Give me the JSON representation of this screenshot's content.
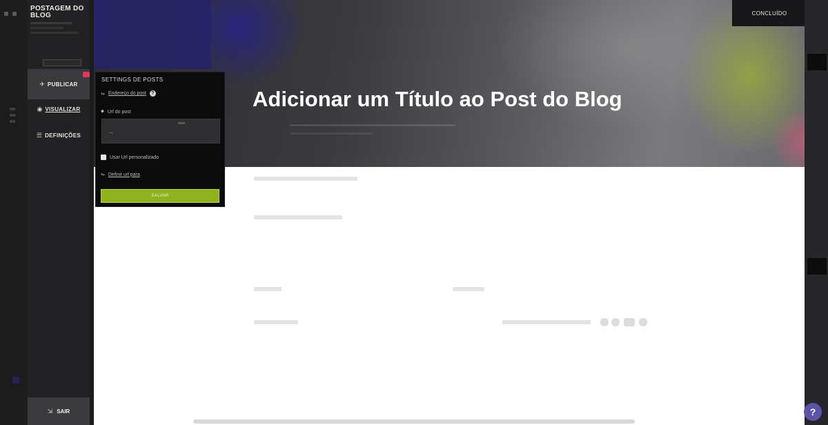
{
  "sidebar": {
    "brand_title": "POSTAGEM DO BLOG",
    "nav": {
      "publish_label": "PUBLICAR",
      "preview_label": "VISUALIZAR",
      "settings_label": "DEFINIÇÕES"
    },
    "exit_label": "SAIR"
  },
  "header": {
    "done_label": "CONCLUÍDO"
  },
  "hero": {
    "title": "Adicionar um Título ao Post do Blog"
  },
  "settings_popup": {
    "title": "SETTINGS DE POSTS",
    "address_link": "Endereço do post",
    "url_label": "Url do post",
    "custom_url_label": "Usar Url personalizado",
    "define_link": "Definir url para",
    "save_button": "SALVAR"
  },
  "colors": {
    "accent_green": "#8fb21e",
    "notification_red": "#e2375d",
    "help_purple": "#5b54a8"
  }
}
